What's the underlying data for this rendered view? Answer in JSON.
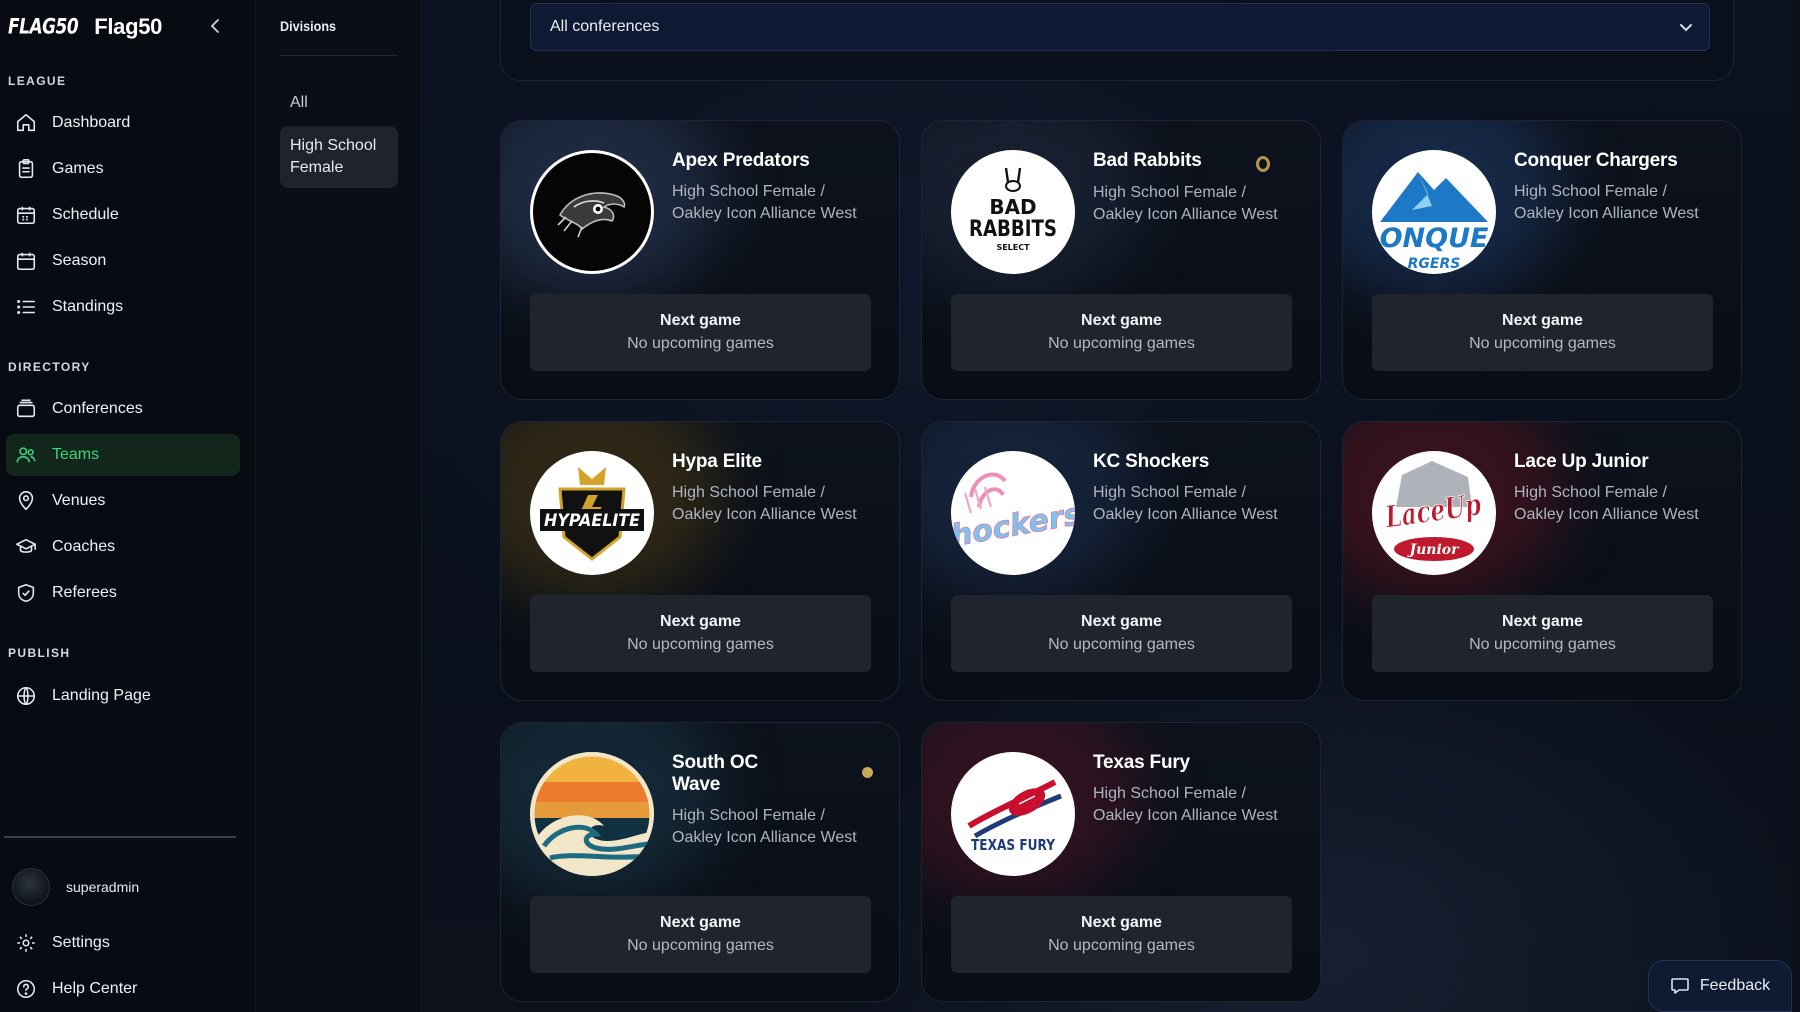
{
  "brand": {
    "logo_text": "FLAG50",
    "name": "Flag50"
  },
  "sidebar": {
    "sections": {
      "league": "LEAGUE",
      "directory": "DIRECTORY",
      "publish": "PUBLISH"
    },
    "league_items": [
      {
        "label": "Dashboard",
        "icon": "home-icon"
      },
      {
        "label": "Games",
        "icon": "clipboard-icon"
      },
      {
        "label": "Schedule",
        "icon": "calendar-grid-icon"
      },
      {
        "label": "Season",
        "icon": "calendar-icon"
      },
      {
        "label": "Standings",
        "icon": "list-icon"
      }
    ],
    "directory_items": [
      {
        "label": "Conferences",
        "icon": "layers-icon"
      },
      {
        "label": "Teams",
        "icon": "users-icon",
        "active": true
      },
      {
        "label": "Venues",
        "icon": "map-pin-icon"
      },
      {
        "label": "Coaches",
        "icon": "graduation-cap-icon"
      },
      {
        "label": "Referees",
        "icon": "shield-check-icon"
      }
    ],
    "publish_items": [
      {
        "label": "Landing Page",
        "icon": "globe-icon"
      }
    ],
    "user": {
      "name": "superadmin"
    },
    "footer_items": [
      {
        "label": "Settings",
        "icon": "gear-icon"
      },
      {
        "label": "Help Center",
        "icon": "help-circle-icon"
      }
    ],
    "active_color": "#3ed27a"
  },
  "divisions": {
    "title": "Divisions",
    "items": [
      "All",
      "High School Female"
    ],
    "selected": "High School Female"
  },
  "filter": {
    "conference_value": "All conferences"
  },
  "teams": [
    {
      "name": "Apex Predators",
      "division_line1": "High School Female /",
      "division_line2": "Oakley Icon Alliance West",
      "next_title": "Next game",
      "next_status": "No upcoming games"
    },
    {
      "name": "Bad Rabbits",
      "division_line1": "High School Female /",
      "division_line2": "Oakley Icon Alliance West",
      "next_title": "Next game",
      "next_status": "No upcoming games"
    },
    {
      "name": "Conquer Chargers",
      "division_line1": "High School Female /",
      "division_line2": "Oakley Icon Alliance West",
      "next_title": "Next game",
      "next_status": "No upcoming games"
    },
    {
      "name": "Hypa Elite",
      "division_line1": "High School Female /",
      "division_line2": "Oakley Icon Alliance West",
      "next_title": "Next game",
      "next_status": "No upcoming games"
    },
    {
      "name": "KC Shockers",
      "division_line1": "High School Female /",
      "division_line2": "Oakley Icon Alliance West",
      "next_title": "Next game",
      "next_status": "No upcoming games"
    },
    {
      "name": "Lace Up Junior",
      "division_line1": "High School Female /",
      "division_line2": "Oakley Icon Alliance West",
      "next_title": "Next game",
      "next_status": "No upcoming games"
    },
    {
      "name_line1": "South OC",
      "name_line2": "Wave",
      "division_line1": "High School Female /",
      "division_line2": "Oakley Icon Alliance West",
      "next_title": "Next game",
      "next_status": "No upcoming games"
    },
    {
      "name": "Texas Fury",
      "division_line1": "High School Female /",
      "division_line2": "Oakley Icon Alliance West",
      "next_title": "Next game",
      "next_status": "No upcoming games"
    }
  ],
  "logos": {
    "bad_rabbits_line1": "BAD",
    "bad_rabbits_line2": "RABBITS",
    "bad_rabbits_line3": "SELECT",
    "conquer_text": "ONQUE",
    "conquer_sub": "RGERS",
    "hypa_text": "HYPAELITE",
    "kc_text": "hockers",
    "lace_text": "LaceUp",
    "lace_sub": "Junior",
    "texas_text": "TEXAS FURY"
  },
  "feedback": {
    "label": "Feedback"
  }
}
